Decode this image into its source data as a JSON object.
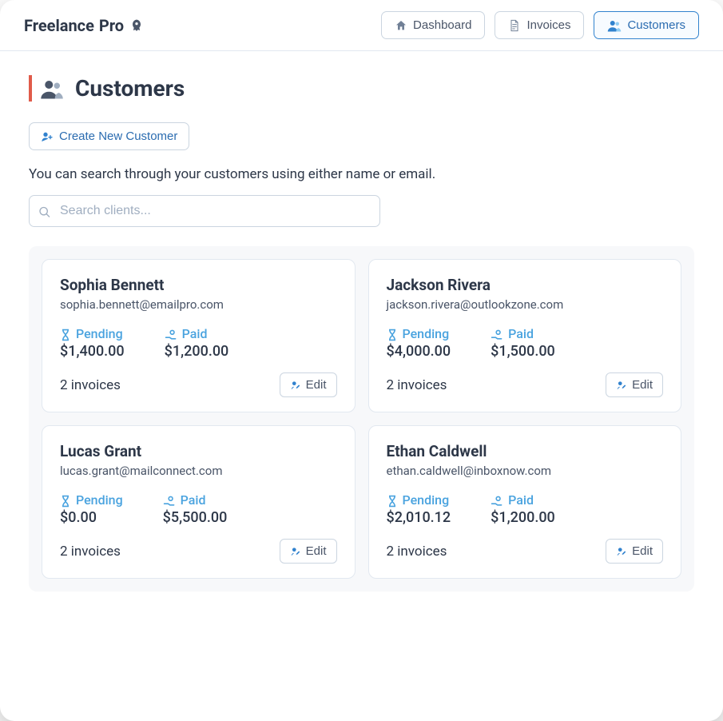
{
  "brand": {
    "name": "Freelance",
    "suffix": "Pro"
  },
  "nav": {
    "dashboard": "Dashboard",
    "invoices": "Invoices",
    "customers": "Customers"
  },
  "page": {
    "title": "Customers",
    "create_label": "Create New Customer",
    "help_text": "You can search through your customers using either name or email.",
    "search_placeholder": "Search clients..."
  },
  "labels": {
    "pending": "Pending",
    "paid": "Paid",
    "edit": "Edit"
  },
  "customers": [
    {
      "name": "Sophia Bennett",
      "email": "sophia.bennett@emailpro.com",
      "pending": "$1,400.00",
      "paid": "$1,200.00",
      "invoice_count": "2 invoices"
    },
    {
      "name": "Jackson Rivera",
      "email": "jackson.rivera@outlookzone.com",
      "pending": "$4,000.00",
      "paid": "$1,500.00",
      "invoice_count": "2 invoices"
    },
    {
      "name": "Lucas Grant",
      "email": "lucas.grant@mailconnect.com",
      "pending": "$0.00",
      "paid": "$5,500.00",
      "invoice_count": "2 invoices"
    },
    {
      "name": "Ethan Caldwell",
      "email": "ethan.caldwell@inboxnow.com",
      "pending": "$2,010.12",
      "paid": "$1,200.00",
      "invoice_count": "2 invoices"
    }
  ]
}
